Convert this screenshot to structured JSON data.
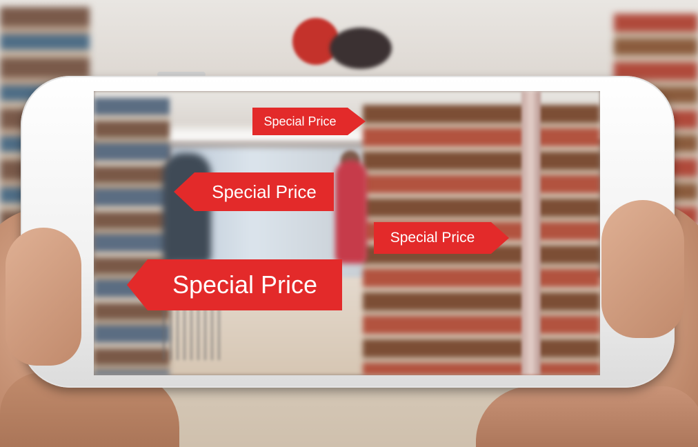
{
  "scene": {
    "description_free": true,
    "colors": {
      "tag_background": "#e32a2a",
      "tag_text": "#ffffff",
      "phone_body": "#f1f1f1"
    }
  },
  "ar_tags": [
    {
      "label": "Special Price",
      "arrow": "right"
    },
    {
      "label": "Special Price",
      "arrow": "left"
    },
    {
      "label": "Special Price",
      "arrow": "right"
    },
    {
      "label": "Special Price",
      "arrow": "left"
    }
  ]
}
